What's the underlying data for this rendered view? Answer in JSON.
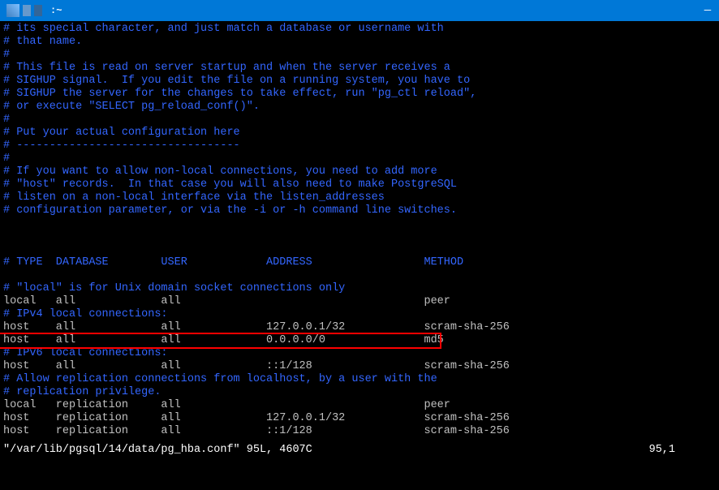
{
  "titlebar": {
    "title": ":~"
  },
  "lines": [
    {
      "cls": "comment",
      "text": "# its special character, and just match a database or username with"
    },
    {
      "cls": "comment",
      "text": "# that name."
    },
    {
      "cls": "comment",
      "text": "#"
    },
    {
      "cls": "comment",
      "text": "# This file is read on server startup and when the server receives a"
    },
    {
      "cls": "comment",
      "text": "# SIGHUP signal.  If you edit the file on a running system, you have to"
    },
    {
      "cls": "comment",
      "text": "# SIGHUP the server for the changes to take effect, run \"pg_ctl reload\","
    },
    {
      "cls": "comment",
      "text": "# or execute \"SELECT pg_reload_conf()\"."
    },
    {
      "cls": "comment",
      "text": "#"
    },
    {
      "cls": "comment",
      "text": "# Put your actual configuration here"
    },
    {
      "cls": "comment",
      "text": "# ----------------------------------"
    },
    {
      "cls": "comment",
      "text": "#"
    },
    {
      "cls": "comment",
      "text": "# If you want to allow non-local connections, you need to add more"
    },
    {
      "cls": "comment",
      "text": "# \"host\" records.  In that case you will also need to make PostgreSQL"
    },
    {
      "cls": "comment",
      "text": "# listen on a non-local interface via the listen_addresses"
    },
    {
      "cls": "comment",
      "text": "# configuration parameter, or via the -i or -h command line switches."
    },
    {
      "cls": "normal",
      "text": ""
    },
    {
      "cls": "normal",
      "text": ""
    },
    {
      "cls": "normal",
      "text": ""
    },
    {
      "cls": "comment",
      "text": "# TYPE  DATABASE        USER            ADDRESS                 METHOD"
    },
    {
      "cls": "normal",
      "text": ""
    },
    {
      "cls": "comment",
      "text": "# \"local\" is for Unix domain socket connections only"
    },
    {
      "cls": "normal",
      "text": "local   all             all                                     peer"
    },
    {
      "cls": "comment",
      "text": "# IPv4 local connections:"
    },
    {
      "cls": "normal",
      "text": "host    all             all             127.0.0.1/32            scram-sha-256"
    },
    {
      "cls": "normal",
      "text": "host    all             all             0.0.0.0/0               md5"
    },
    {
      "cls": "comment",
      "text": "# IPv6 local connections:"
    },
    {
      "cls": "normal",
      "text": "host    all             all             ::1/128                 scram-sha-256"
    },
    {
      "cls": "comment",
      "text": "# Allow replication connections from localhost, by a user with the"
    },
    {
      "cls": "comment",
      "text": "# replication privilege."
    },
    {
      "cls": "normal",
      "text": "local   replication     all                                     peer"
    },
    {
      "cls": "normal",
      "text": "host    replication     all             127.0.0.1/32            scram-sha-256"
    },
    {
      "cls": "normal",
      "text": "host    replication     all             ::1/128                 scram-sha-256"
    }
  ],
  "status": {
    "left": "\"/var/lib/pgsql/14/data/pg_hba.conf\" 95L, 4607C",
    "right": "95,1"
  }
}
